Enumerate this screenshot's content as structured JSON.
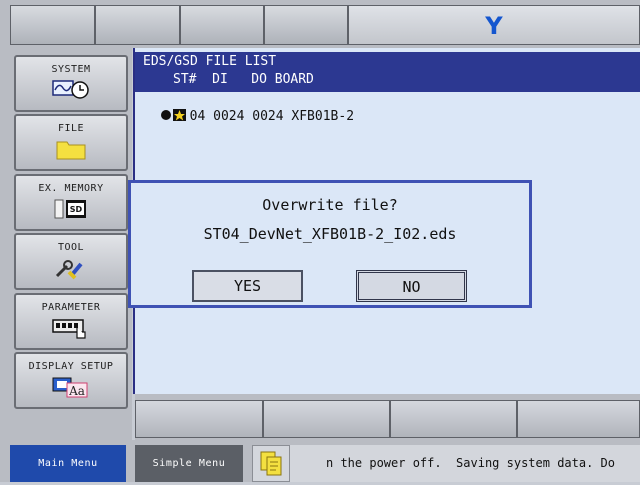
{
  "top": {
    "title_letter": "Y"
  },
  "menu": [
    {
      "label": "SYSTEM",
      "icon": "waveform-clock-icon"
    },
    {
      "label": "FILE",
      "icon": "folder-icon"
    },
    {
      "label": "EX. MEMORY",
      "icon": "sd-card-icon"
    },
    {
      "label": "TOOL",
      "icon": "wrench-tools-icon"
    },
    {
      "label": "PARAMETER",
      "icon": "parameter-keypad-icon"
    },
    {
      "label": "DISPLAY SETUP",
      "icon": "display-font-icon"
    }
  ],
  "list": {
    "title": "EDS/GSD FILE LIST",
    "columns": "ST#  DI   DO BOARD",
    "row": "04 0024 0024 XFB01B-2"
  },
  "dialog": {
    "question": "Overwrite file?",
    "filename": "ST04_DevNet_XFB01B-2_I02.eds",
    "yes": "YES",
    "no": "NO"
  },
  "status": {
    "main_menu": "Main Menu",
    "simple_menu": "Simple Menu",
    "message": "n the power off.  Saving system data. Do"
  },
  "colors": {
    "accent": "#2c3891",
    "highlight": "#1f4aab",
    "title_letter": "#1456cf"
  }
}
